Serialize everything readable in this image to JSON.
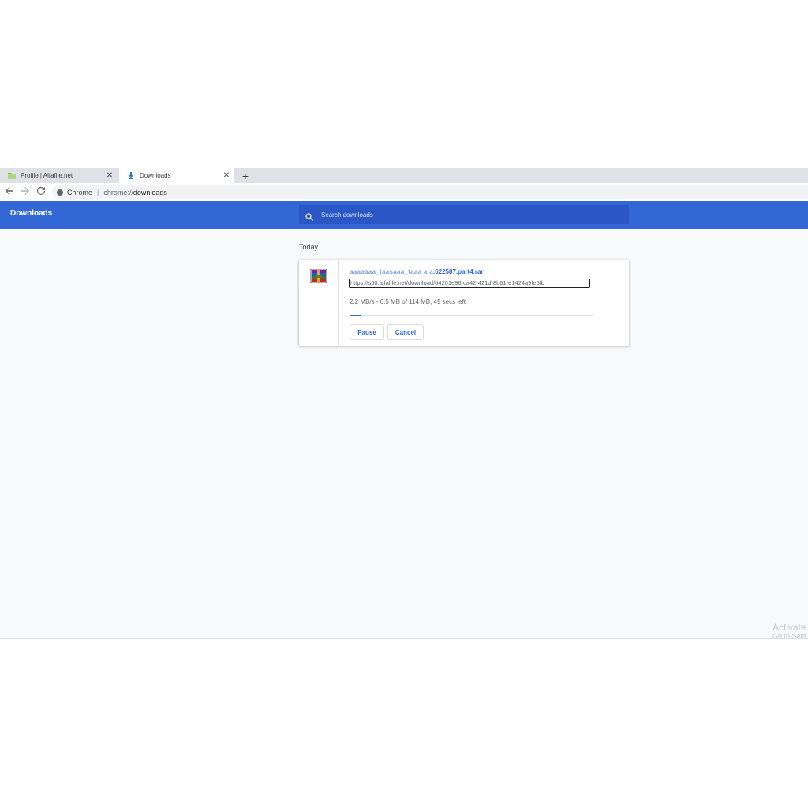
{
  "tabs": [
    {
      "title": "Profile | Alfafile.net",
      "icon": "folder-icon",
      "active": false
    },
    {
      "title": "Downloads",
      "icon": "download-icon",
      "active": true
    }
  ],
  "toolbar": {
    "site_chip": "Chrome",
    "separator": "|",
    "url_scheme": "chrome://",
    "url_path": "downloads"
  },
  "header": {
    "title": "Downloads",
    "search_placeholder": "Search downloads"
  },
  "section": {
    "label": "Today"
  },
  "download": {
    "file_name_obscured": "aaaaaaa_taasaaa_taaa a a",
    "file_name_visible": ".622587.part4.rar",
    "url": "https://s60.alfafile.net/download/64201e96-ca42-421d-8b61-e1424a9fe5fb",
    "status": "2.2 MB/s - 6.5 MB of 114 MB, 49 secs left",
    "progress_fraction": 0.05,
    "pause_label": "Pause",
    "cancel_label": "Cancel"
  },
  "watermark": {
    "line1": "Activate",
    "line2": "Go to Setti"
  },
  "colors": {
    "header_blue": "#3367d6",
    "search_blue": "#2a56c6",
    "link_blue": "#3367d6"
  }
}
